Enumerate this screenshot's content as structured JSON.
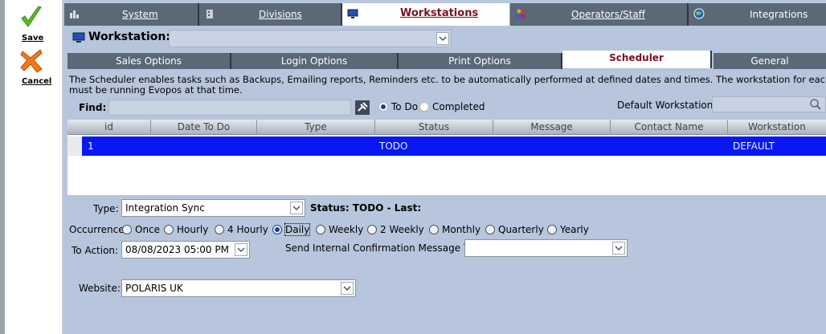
{
  "left_toolbar": {
    "save_label": "Save",
    "cancel_label": "Cancel"
  },
  "top_tabs": [
    {
      "label": "System",
      "icon": "chart-icon",
      "active": false
    },
    {
      "label": "Divisions",
      "icon": "building-icon",
      "active": false
    },
    {
      "label": "Workstations",
      "icon": "monitor-icon",
      "active": true
    },
    {
      "label": "Operators/Staff",
      "icon": "people-icon",
      "active": false
    },
    {
      "label": "Integrations",
      "icon": "globe-icon",
      "active": false
    }
  ],
  "workstation": {
    "label": "Workstation:",
    "value": ""
  },
  "sub_tabs": [
    {
      "label": "Sales Options",
      "active": false
    },
    {
      "label": "Login Options",
      "active": false
    },
    {
      "label": "Print Options",
      "active": false
    },
    {
      "label": "Scheduler",
      "active": true
    },
    {
      "label": "General",
      "active": false
    }
  ],
  "description": {
    "line1": "The Scheduler enables tasks such as Backups, Emailing reports, Reminders etc. to be automatically performed at defined dates and times.  The  workstation for each Sched",
    "line2": "must be running Evopos at that time."
  },
  "find": {
    "label": "Find:",
    "value": "",
    "filter_options": [
      {
        "label": "To Do",
        "selected": true
      },
      {
        "label": "Completed",
        "selected": false
      }
    ],
    "default_workstation_label": "Default Workstation",
    "default_workstation_value": ""
  },
  "grid": {
    "columns": [
      "id",
      "Date To Do",
      "Type",
      "Status",
      "Message",
      "Contact Name",
      "Workstation"
    ],
    "rows": [
      {
        "id": "1",
        "date_to_do": "",
        "type": "",
        "status": "TODO",
        "message": "",
        "contact_name": "",
        "workstation": "DEFAULT",
        "selected": true
      }
    ],
    "selected_row_color": "#0818f4"
  },
  "form": {
    "type_label": "Type:",
    "type_value": "Integration Sync",
    "status_text": "Status: TODO - Last:",
    "occurrence_label": "Occurrence:",
    "occurrence_options": [
      {
        "label": "Once",
        "selected": false
      },
      {
        "label": "Hourly",
        "selected": false
      },
      {
        "label": "4 Hourly",
        "selected": false
      },
      {
        "label": "Daily",
        "selected": true
      },
      {
        "label": "Weekly",
        "selected": false
      },
      {
        "label": "2 Weekly",
        "selected": false
      },
      {
        "label": "Monthly",
        "selected": false
      },
      {
        "label": "Quarterly",
        "selected": false
      },
      {
        "label": "Yearly",
        "selected": false
      }
    ],
    "to_action_label": "To Action:",
    "to_action_value": "08/08/2023 05:00 PM",
    "confirm_label": "Send Internal Confirmation Message To:",
    "confirm_value": "",
    "website_label": "Website:",
    "website_value": "POLARIS UK"
  },
  "colors": {
    "tab_dark": "#5a6878",
    "active_tab_text": "#7a1020",
    "panel_bg": "#b7c6dc"
  }
}
